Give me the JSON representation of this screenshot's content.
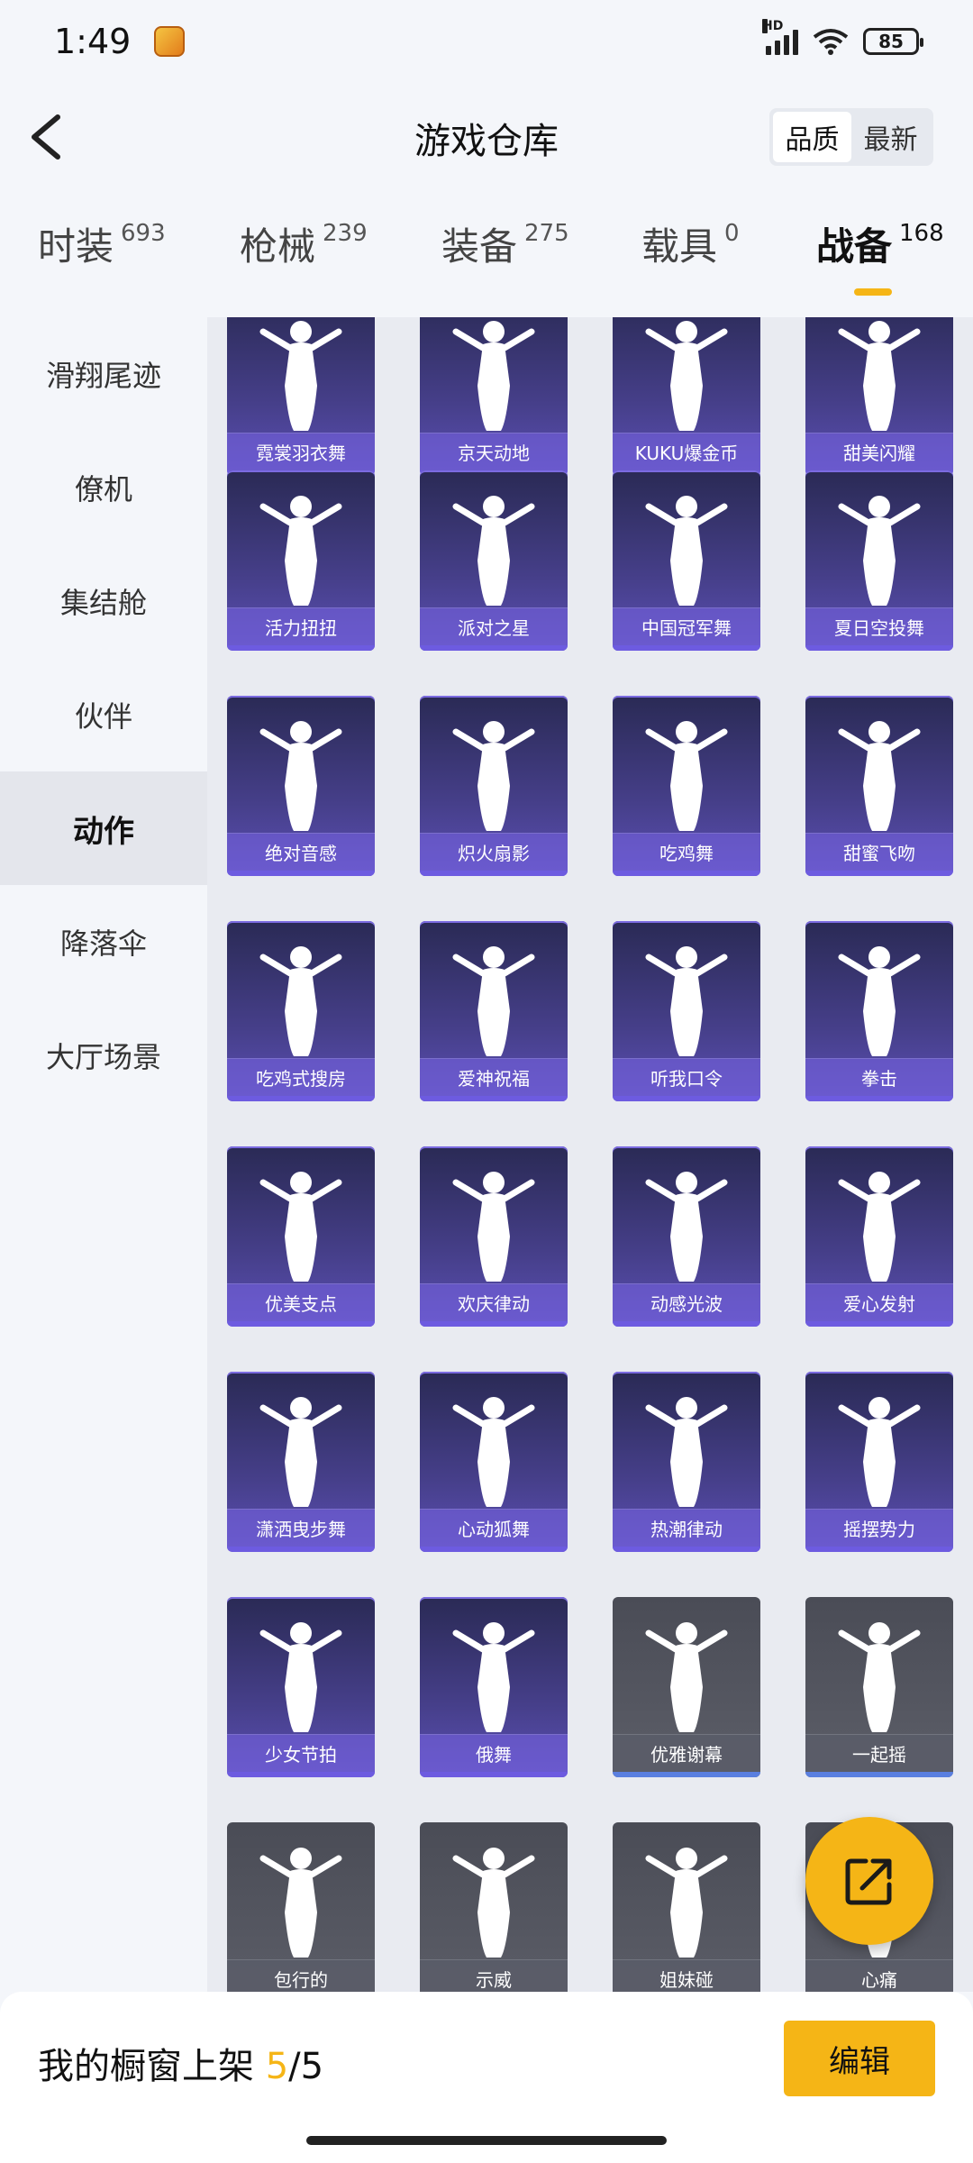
{
  "status": {
    "time": "1:49",
    "battery": "85",
    "network": "HD"
  },
  "header": {
    "title": "游戏仓库",
    "sort": [
      "品质",
      "最新"
    ],
    "active_sort": 0
  },
  "tabs": [
    {
      "label": "时装",
      "count": "693"
    },
    {
      "label": "枪械",
      "count": "239"
    },
    {
      "label": "装备",
      "count": "275"
    },
    {
      "label": "载具",
      "count": "0"
    },
    {
      "label": "战备",
      "count": "168"
    }
  ],
  "active_tab": 4,
  "sidebar": [
    "滑翔尾迹",
    "僚机",
    "集结舱",
    "伙伴",
    "动作",
    "降落伞",
    "大厅场景"
  ],
  "active_sidebar": 4,
  "items": [
    "霓裳羽衣舞",
    "京天动地",
    "KUKU爆金币",
    "甜美闪耀",
    "活力扭扭",
    "派对之星",
    "中国冠军舞",
    "夏日空投舞",
    "绝对音感",
    "炽火扇影",
    "吃鸡舞",
    "甜蜜飞吻",
    "吃鸡式搜房",
    "爱神祝福",
    "听我口令",
    "拳击",
    "优美支点",
    "欢庆律动",
    "动感光波",
    "爱心发射",
    "潇洒曳步舞",
    "心动狐舞",
    "热潮律动",
    "摇摆势力",
    "少女节拍",
    "俄舞",
    "优雅谢幕",
    "一起摇",
    "包行的",
    "示威",
    "姐妹碰",
    "心痛"
  ],
  "bottom": {
    "shelf_label": "我的橱窗上架",
    "shelf_used": "5",
    "shelf_sep": "/",
    "shelf_total": "5",
    "edit": "编辑"
  }
}
